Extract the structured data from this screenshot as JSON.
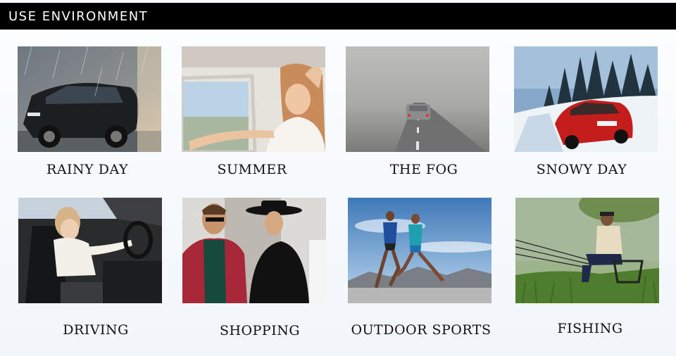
{
  "header": {
    "title": "USE ENVIRONMENT"
  },
  "tiles": [
    {
      "caption": "RAINY DAY"
    },
    {
      "caption": "SUMMER"
    },
    {
      "caption": "THE FOG"
    },
    {
      "caption": "SNOWY DAY"
    },
    {
      "caption": "DRIVING"
    },
    {
      "caption": "SHOPPING"
    },
    {
      "caption": "OUTDOOR SPORTS"
    },
    {
      "caption": "FISHING"
    }
  ]
}
